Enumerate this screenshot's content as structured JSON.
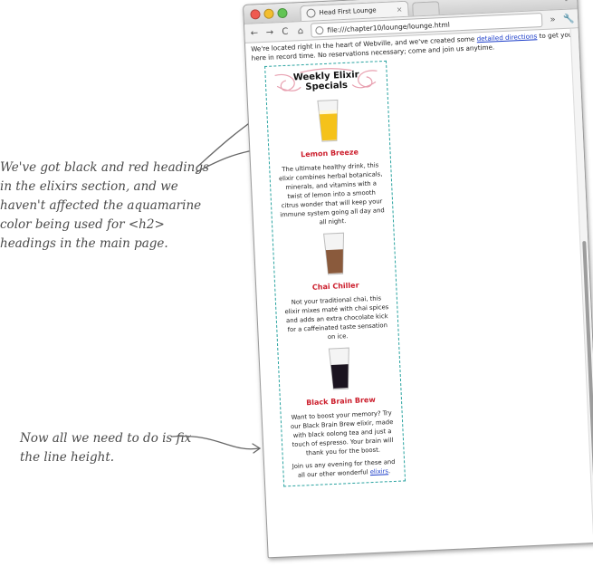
{
  "annotations": {
    "note_top": "We've got black and red headings in the elixirs section, and we haven't affected the aquamarine color being used for <h2> headings in the main page.",
    "note_bottom": "Now all we need to do is fix the line height."
  },
  "browser": {
    "tab_title": "Head First Lounge",
    "tab_close": "×",
    "address": "file:///chapter10/lounge/lounge.html",
    "nav": {
      "back": "←",
      "forward": "→",
      "reload": "C",
      "home": "⌂",
      "more": "»",
      "wrench": "🔧"
    }
  },
  "page": {
    "intro_prefix": "We're located right in the heart of Webville, and we've created some ",
    "intro_link": "detailed directions",
    "intro_suffix": " to get you here in record time. No reservations necessary; come and join us anytime.",
    "sidebar": {
      "title": "Weekly Elixir Specials",
      "elixirs": [
        {
          "name": "Lemon Breeze",
          "description": "The ultimate healthy drink, this elixir combines herbal botanicals, minerals, and vitamins with a twist of lemon into a smooth citrus wonder that will keep your immune system going all day and all night.",
          "color": "#f5c21a"
        },
        {
          "name": "Chai Chiller",
          "description": "Not your traditional chai, this elixir mixes maté with chai spices and adds an extra chocolate kick for a caffeinated taste sensation on ice.",
          "color": "#8a5a3c"
        },
        {
          "name": "Black Brain Brew",
          "description": "Want to boost your memory? Try our Black Brain Brew elixir, made with black oolong tea and just a touch of espresso. Your brain will thank you for the boost.",
          "color": "#1b1420"
        }
      ],
      "footer_prefix": "Join us any evening for these and all our other wonderful ",
      "footer_link": "elixirs",
      "footer_suffix": "."
    }
  },
  "colors": {
    "heading_red": "#cc1f2d",
    "border_aquamarine": "#29a3a0",
    "link_blue": "#1a3cc9"
  }
}
